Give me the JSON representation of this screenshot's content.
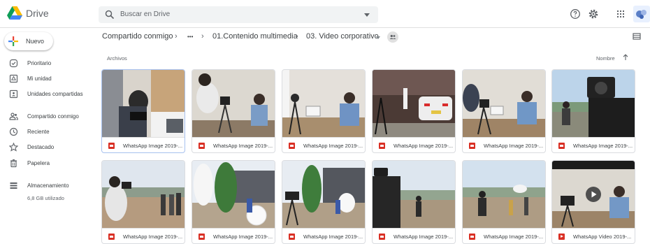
{
  "app": {
    "name": "Drive"
  },
  "search": {
    "placeholder": "Buscar en Drive"
  },
  "sidebar": {
    "new_label": "Nuevo",
    "items": [
      {
        "label": "Prioritario",
        "icon": "check-circle-icon"
      },
      {
        "label": "Mi unidad",
        "icon": "my-drive-icon"
      },
      {
        "label": "Unidades compartidas",
        "icon": "shared-drives-icon"
      },
      {
        "label": "Compartido conmigo",
        "icon": "people-icon"
      },
      {
        "label": "Reciente",
        "icon": "clock-icon"
      },
      {
        "label": "Destacado",
        "icon": "star-icon"
      },
      {
        "label": "Papelera",
        "icon": "trash-icon"
      },
      {
        "label": "Almacenamiento",
        "icon": "storage-icon"
      }
    ],
    "storage_used": "6,8 GB utilizado"
  },
  "breadcrumb": {
    "root": "Compartido conmigo",
    "ellipsis": "•••",
    "parent": "01.Contenido multimedia",
    "current": "03. Video corporativo",
    "separator": "›"
  },
  "section": {
    "label": "Archivos",
    "sort_label": "Nombre"
  },
  "colors": {
    "accent": "#1a73e8",
    "image_icon": "#d93025",
    "video_icon": "#d93025",
    "selected_border": "#a7c1ef"
  },
  "files": [
    {
      "name": "WhatsApp Image 2019-...",
      "type": "image"
    },
    {
      "name": "WhatsApp Image 2019-...",
      "type": "image"
    },
    {
      "name": "WhatsApp Image 2019-...",
      "type": "image"
    },
    {
      "name": "WhatsApp Image 2019-...",
      "type": "image"
    },
    {
      "name": "WhatsApp Image 2019-...",
      "type": "image"
    },
    {
      "name": "WhatsApp Image 2019-...",
      "type": "image"
    },
    {
      "name": "WhatsApp Image 2019-...",
      "type": "image"
    },
    {
      "name": "WhatsApp Image 2019-...",
      "type": "image"
    },
    {
      "name": "WhatsApp Image 2019-...",
      "type": "image"
    },
    {
      "name": "WhatsApp Image 2019-...",
      "type": "image"
    },
    {
      "name": "WhatsApp Image 2019-...",
      "type": "image"
    },
    {
      "name": "WhatsApp Video 2019-...",
      "type": "video"
    }
  ]
}
